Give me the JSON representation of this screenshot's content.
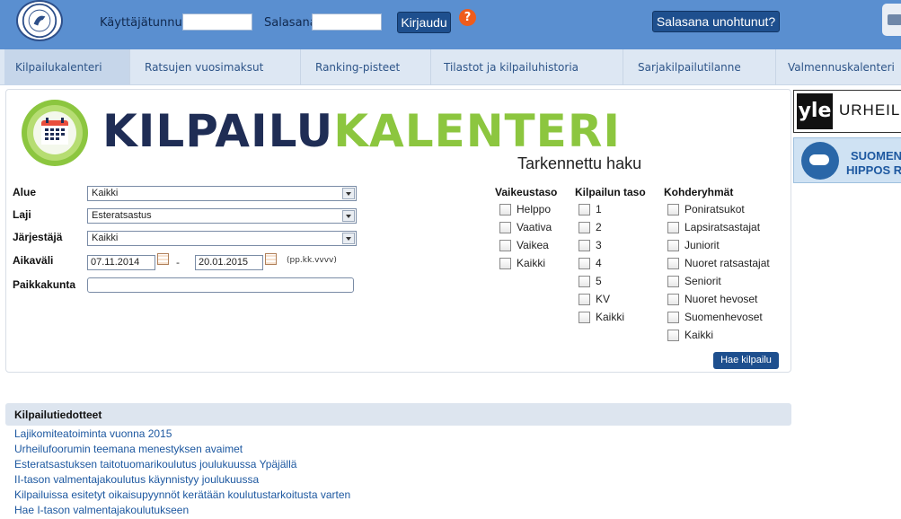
{
  "header": {
    "username_label": "Käyttäjätunnus",
    "username_value": "",
    "password_label": "Salasana",
    "password_value": "",
    "login_button": "Kirjaudu",
    "help_symbol": "?",
    "forgot_password_button": "Salasana unohtunut?"
  },
  "nav": {
    "items": [
      "Kilpailukalenteri",
      "Ratsujen vuosimaksut",
      "Ranking-pisteet",
      "Tilastot ja kilpailuhistoria",
      "Sarjakilpailutilanne",
      "Valmennuskalenteri"
    ],
    "active": "Kilpailukalenteri"
  },
  "calendar": {
    "title_part1": "KILPAILU",
    "title_part2": "KALENTERI",
    "advanced_search_title": "Tarkennettu haku",
    "fields": {
      "area_label": "Alue",
      "area_value": "Kaikki",
      "discipline_label": "Laji",
      "discipline_value": "Esteratsastus",
      "organizer_label": "Järjestäjä",
      "organizer_value": "Kaikki",
      "period_label": "Aikaväli",
      "date_from": "07.11.2014",
      "date_separator": "-",
      "date_to": "20.01.2015",
      "date_format_hint": "(pp.kk.vvvv)",
      "location_label": "Paikkakunta",
      "location_value": ""
    },
    "difficulty": {
      "header": "Vaikeustaso",
      "options": [
        "Helppo",
        "Vaativa",
        "Vaikea",
        "Kaikki"
      ]
    },
    "level": {
      "header": "Kilpailun taso",
      "options": [
        "1",
        "2",
        "3",
        "4",
        "5",
        "KV",
        "Kaikki"
      ]
    },
    "target": {
      "header": "Kohderyhmät",
      "options": [
        "Poniratsukot",
        "Lapsiratsastajat",
        "Juniorit",
        "Nuoret ratsastajat",
        "Seniorit",
        "Nuoret hevoset",
        "Suomenhevoset",
        "Kaikki"
      ]
    },
    "search_button": "Hae kilpailu"
  },
  "ads": {
    "yle_mark": "yle",
    "yle_text": "URHEIL",
    "hippos_line1": "SUOMEN",
    "hippos_line2": "HIPPOS R"
  },
  "news": {
    "title": "Kilpailutiedotteet",
    "items": [
      "Lajikomiteatoiminta vuonna 2015",
      "Urheilufoorumin teemana menestyksen avaimet",
      "Esteratsastuksen taitotuomarikoulutus joulukuussa Ypäjällä",
      "II-tason valmentajakoulutus käynnistyy joulukuussa",
      "Kilpailuissa esitetyt oikaisupyynnöt kerätään koulutustarkoitusta varten",
      "Hae I-tason valmentajakoulutukseen"
    ]
  },
  "colors": {
    "header_bg": "#5a8fd0",
    "button_dark": "#1e4f8e",
    "nav_bg": "#dde7f3",
    "title_dark": "#1f2d55",
    "title_green": "#8cc63f",
    "help_orange": "#ef5c1c",
    "link": "#1d58a0"
  }
}
